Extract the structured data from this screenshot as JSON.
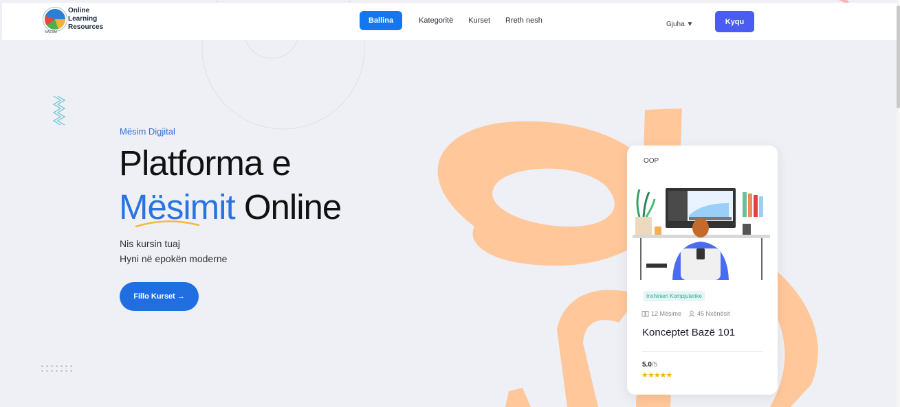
{
  "brand": {
    "line1": "Online",
    "line2": "Learning",
    "line3": "Resources",
    "small": "NAESM"
  },
  "nav": {
    "items": [
      "Ballina",
      "Kategoritë",
      "Kurset",
      "Rreth nesh"
    ],
    "active_index": 0
  },
  "header": {
    "language_label": "Gjuha ▼",
    "login_label": "Kyqu"
  },
  "hero": {
    "eyebrow": "Mësim Digjital",
    "title_line1": "Platforma e",
    "title_accent": "Mësimit",
    "title_rest": " Online",
    "subtitle_line1": "Nis kursin tuaj",
    "subtitle_line2": "Hyni në epokën moderne",
    "cta_label": "Fillo Kurset →"
  },
  "course_card": {
    "category": "OOP",
    "tag": "Inxhinieri Kompjuterike",
    "lessons": "12 Mësime",
    "students": "45 Nxënësit",
    "title": "Konceptet Bazë 101",
    "rating": "5.0",
    "rating_max": "/5",
    "stars": "★★★★★"
  },
  "colors": {
    "primary": "#1477f0",
    "login": "#4a5cf2",
    "accent_text": "#2a73e0",
    "peach": "#ffc79a",
    "underline": "#f5b83a"
  }
}
